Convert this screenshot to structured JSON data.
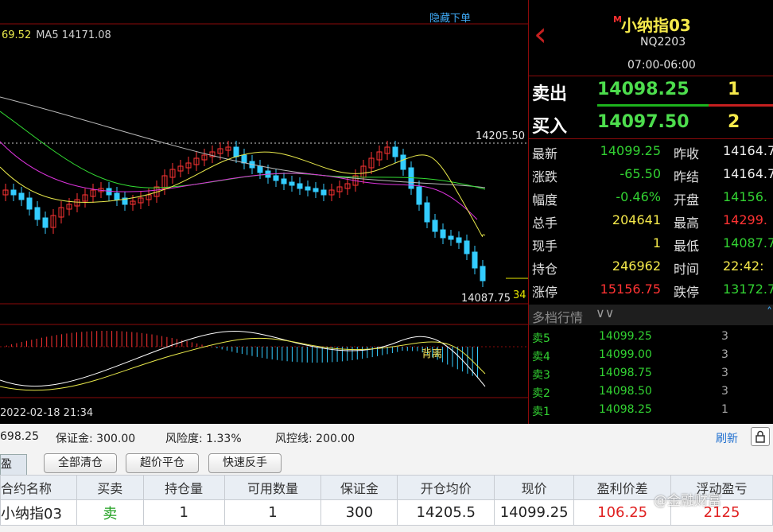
{
  "chart": {
    "hide_order_link": "隐藏下单",
    "ma_legend": {
      "partial_value": "69.52",
      "ma5_text": "MA5 14171.08"
    },
    "price_high_label": "14205.50",
    "price_low_label": "14087.75",
    "price_right_partial": "34",
    "macd_annotation": "背离",
    "timestamp": "2022-02-18 21:34"
  },
  "quote": {
    "symbol_marker": "M",
    "symbol_name": "小纳指03",
    "contract_code": "NQ2203",
    "trading_hours": "07:00-06:00",
    "ask": {
      "label": "卖出",
      "price": "14098.25",
      "qty": "1"
    },
    "bid": {
      "label": "买入",
      "price": "14097.50",
      "qty": "2"
    },
    "stats": [
      {
        "l1": "最新",
        "v1": "14099.25",
        "c1": "green",
        "l2": "昨收",
        "v2": "14164.7",
        "c2": "white"
      },
      {
        "l1": "涨跌",
        "v1": "-65.50",
        "c1": "green",
        "l2": "昨结",
        "v2": "14164.7",
        "c2": "white"
      },
      {
        "l1": "幅度",
        "v1": "-0.46%",
        "c1": "green",
        "l2": "开盘",
        "v2": "14156.",
        "c2": "green"
      },
      {
        "l1": "总手",
        "v1": "204641",
        "c1": "yellow",
        "l2": "最高",
        "v2": "14299.",
        "c2": "red"
      },
      {
        "l1": "现手",
        "v1": "1",
        "c1": "yellow",
        "l2": "最低",
        "v2": "14087.7",
        "c2": "green"
      },
      {
        "l1": "持仓",
        "v1": "246962",
        "c1": "yellow",
        "l2": "时间",
        "v2": "22:42:",
        "c2": "yellow"
      },
      {
        "l1": "涨停",
        "v1": "15156.75",
        "c1": "red",
        "l2": "跌停",
        "v2": "13172.7",
        "c2": "green"
      }
    ],
    "depth_title": "多档行情",
    "depth": [
      {
        "level": "卖5",
        "price": "14099.25",
        "qty": "3"
      },
      {
        "level": "卖4",
        "price": "14099.00",
        "qty": "3"
      },
      {
        "level": "卖3",
        "price": "14098.75",
        "qty": "3"
      },
      {
        "level": "卖2",
        "price": "14098.50",
        "qty": "3"
      },
      {
        "level": "卖1",
        "price": "14098.25",
        "qty": "1"
      }
    ]
  },
  "account": {
    "partial_value": "698.25",
    "margin": "保证金: 300.00",
    "risk": "风险度: 1.33%",
    "risk_line": "风控线: 200.00",
    "refresh": "刷新"
  },
  "buttons": {
    "tab_partial": "止盈",
    "close_all": "全部清仓",
    "super_close": "超价平仓",
    "quick_reverse": "快速反手"
  },
  "table": {
    "headers": [
      "合约名称",
      "买卖",
      "持仓量",
      "可用数量",
      "保证金",
      "开仓均价",
      "现价",
      "盈利价差",
      "浮动盈亏"
    ],
    "row": [
      "小纳指03",
      "卖",
      "1",
      "1",
      "300",
      "14205.5",
      "14099.25",
      "106.25",
      "2125"
    ]
  },
  "watermark": "@金融财富",
  "colors": {
    "up": "#ff3333",
    "down": "#32d232",
    "accent_blue": "#3fa9f5",
    "panel_border": "#8b0a0a"
  }
}
